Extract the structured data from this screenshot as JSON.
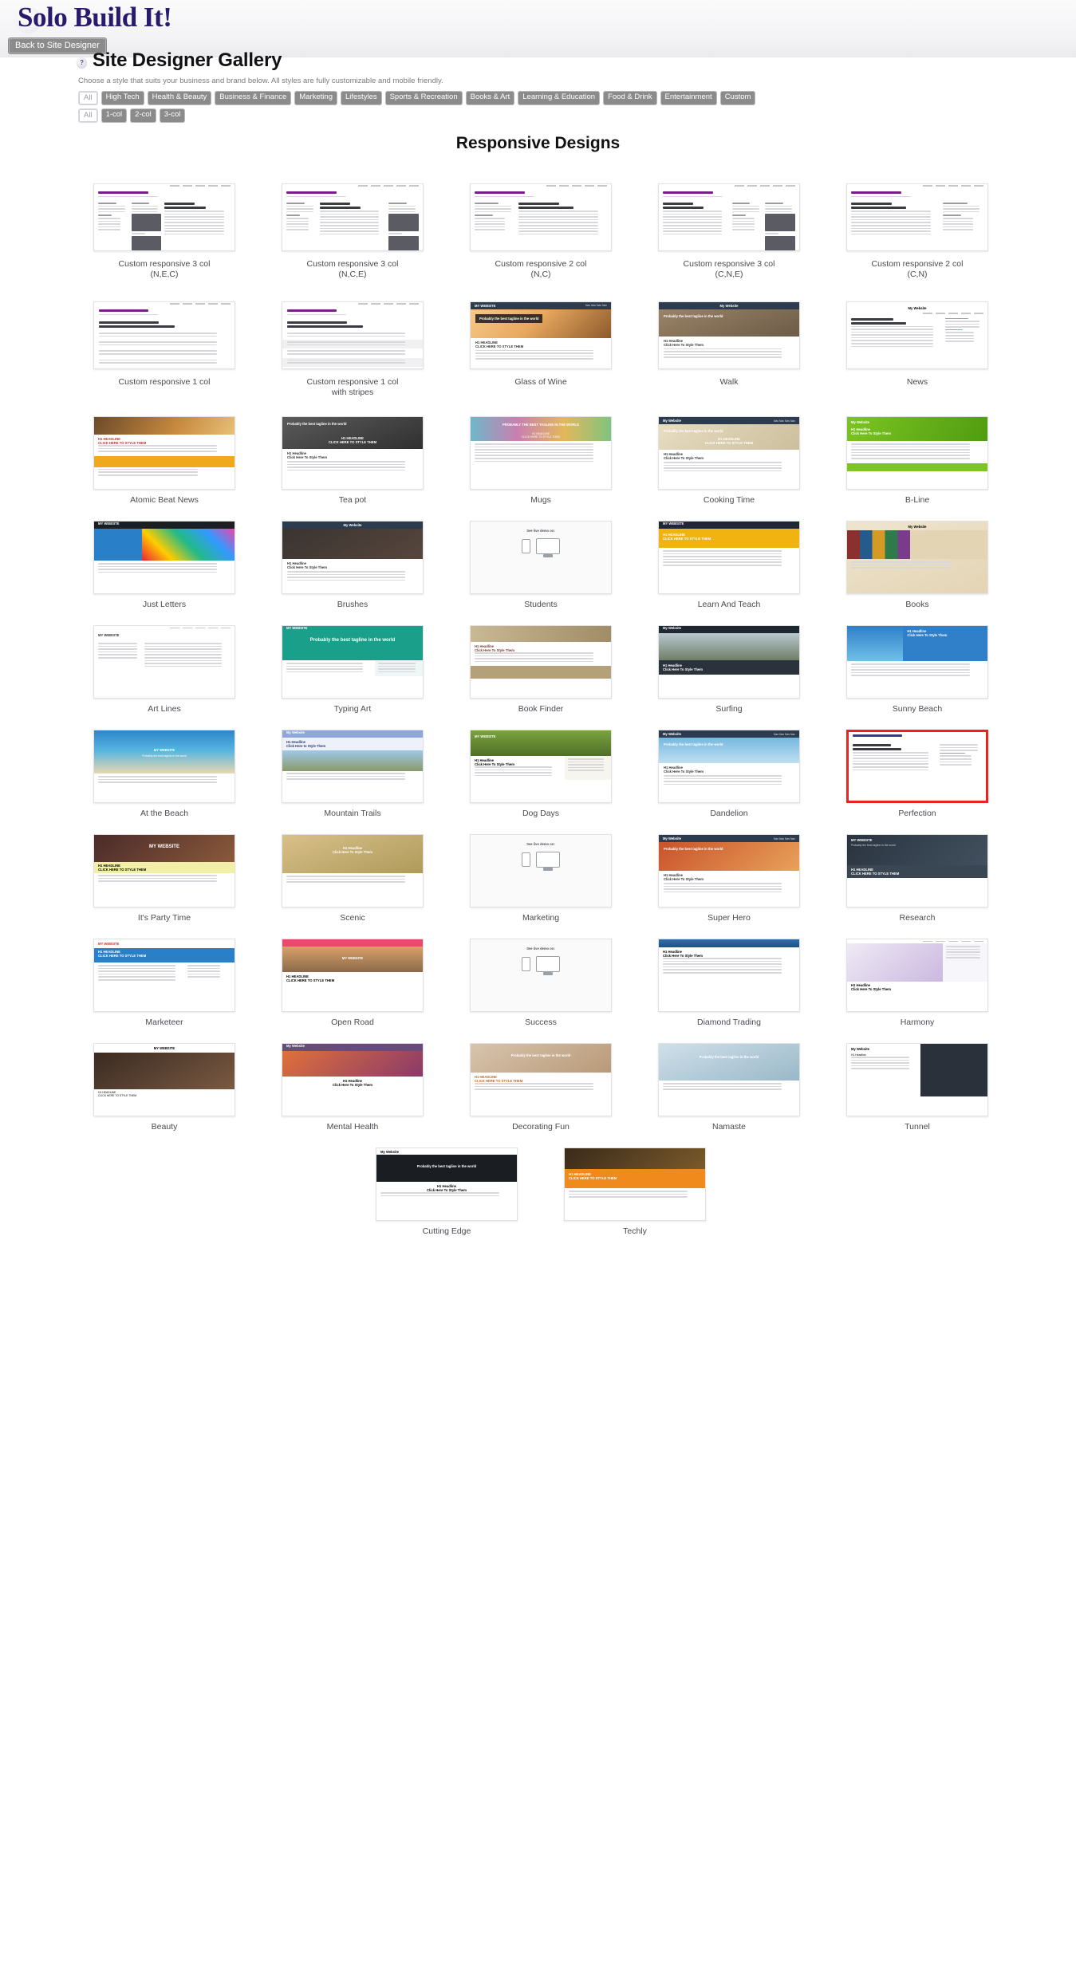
{
  "brand": {
    "name": "Solo Build It!"
  },
  "nav": {
    "back_label": "Back to Site Designer"
  },
  "header": {
    "help_glyph": "?",
    "title": "Site Designer Gallery",
    "subtitle": "Choose a style that suits your business and brand below. All styles are fully customizable and mobile friendly."
  },
  "filters": {
    "category_tags": [
      "All",
      "High Tech",
      "Health & Beauty",
      "Business & Finance",
      "Marketing",
      "Lifestyles",
      "Sports & Recreation",
      "Books & Art",
      "Learning & Education",
      "Food & Drink",
      "Entertainment",
      "Custom"
    ],
    "column_tags": [
      "All",
      "1-col",
      "2-col",
      "3-col"
    ]
  },
  "section": {
    "heading": "Responsive Designs"
  },
  "colors": {
    "brand_purple": "#2a1a6e",
    "tag_grey": "#8b8b8b",
    "selected_red": "#e8241c",
    "caption_grey": "#4a4a52"
  },
  "mini_page_text": {
    "site_name": "My Website",
    "tagline": "Probably the best tagline in the world",
    "h1_line1": "H1 Headline",
    "h1_line2": "Click Here To Style Them",
    "h1_line2_alt": "Click Here to Style Them",
    "h1_caps_line1": "H1 HEADLINE",
    "h1_caps_line2": "CLICK HERE TO STYLE THEM",
    "site_name_caps": "MY WEBSITE",
    "demo_notice": "See live demo on:",
    "nav_column": "Navigation Column",
    "extra_column": "Extra Column"
  },
  "designs": [
    {
      "id": 1,
      "label": "Custom responsive 3 col (N,E,C)",
      "line1": "Custom responsive 3 col",
      "line2": "(N,E,C)",
      "style": "wire3",
      "selected": false
    },
    {
      "id": 2,
      "label": "Custom responsive 3 col (N,C,E)",
      "line1": "Custom responsive 3 col",
      "line2": "(N,C,E)",
      "style": "wire3b",
      "selected": false
    },
    {
      "id": 3,
      "label": "Custom responsive 2 col (N,C)",
      "line1": "Custom responsive 2 col",
      "line2": "(N,C)",
      "style": "wire2",
      "selected": false
    },
    {
      "id": 4,
      "label": "Custom responsive 3 col (C,N,E)",
      "line1": "Custom responsive 3 col",
      "line2": "(C,N,E)",
      "style": "wire3c",
      "selected": false
    },
    {
      "id": 5,
      "label": "Custom responsive 2 col (C,N)",
      "line1": "Custom responsive 2 col",
      "line2": "(C,N)",
      "style": "wire2b",
      "selected": false
    },
    {
      "id": 6,
      "label": "Custom responsive 1 col",
      "line1": "Custom responsive 1 col",
      "line2": "",
      "style": "wire1",
      "selected": false
    },
    {
      "id": 7,
      "label": "Custom responsive 1 col with stripes",
      "line1": "Custom responsive 1 col",
      "line2": "with stripes",
      "style": "wire1s",
      "selected": false
    },
    {
      "id": 8,
      "label": "Glass of Wine",
      "line1": "Glass of Wine",
      "line2": "",
      "style": "wine",
      "selected": false
    },
    {
      "id": 9,
      "label": "Walk",
      "line1": "Walk",
      "line2": "",
      "style": "walk",
      "selected": false
    },
    {
      "id": 10,
      "label": "News",
      "line1": "News",
      "line2": "",
      "style": "news",
      "selected": false
    },
    {
      "id": 11,
      "label": "Atomic Beat News",
      "line1": "Atomic Beat News",
      "line2": "",
      "style": "atomic",
      "selected": false
    },
    {
      "id": 12,
      "label": "Tea pot",
      "line1": "Tea pot",
      "line2": "",
      "style": "teapot",
      "selected": false
    },
    {
      "id": 13,
      "label": "Mugs",
      "line1": "Mugs",
      "line2": "",
      "style": "mugs",
      "selected": false
    },
    {
      "id": 14,
      "label": "Cooking Time",
      "line1": "Cooking Time",
      "line2": "",
      "style": "cooking",
      "selected": false
    },
    {
      "id": 15,
      "label": "B-Line",
      "line1": "B-Line",
      "line2": "",
      "style": "bline",
      "selected": false
    },
    {
      "id": 16,
      "label": "Just Letters",
      "line1": "Just Letters",
      "line2": "",
      "style": "letters",
      "selected": false
    },
    {
      "id": 17,
      "label": "Brushes",
      "line1": "Brushes",
      "line2": "",
      "style": "brushes",
      "selected": false
    },
    {
      "id": 18,
      "label": "Students",
      "line1": "Students",
      "line2": "",
      "style": "demo",
      "selected": false
    },
    {
      "id": 19,
      "label": "Learn And Teach",
      "line1": "Learn And Teach",
      "line2": "",
      "style": "learn",
      "selected": false
    },
    {
      "id": 20,
      "label": "Books",
      "line1": "Books",
      "line2": "",
      "style": "books",
      "selected": false
    },
    {
      "id": 21,
      "label": "Art Lines",
      "line1": "Art Lines",
      "line2": "",
      "style": "artlines",
      "selected": false
    },
    {
      "id": 22,
      "label": "Typing Art",
      "line1": "Typing Art",
      "line2": "",
      "style": "typing",
      "selected": false
    },
    {
      "id": 23,
      "label": "Book Finder",
      "line1": "Book Finder",
      "line2": "",
      "style": "bookfinder",
      "selected": false
    },
    {
      "id": 24,
      "label": "Surfing",
      "line1": "Surfing",
      "line2": "",
      "style": "surfing",
      "selected": false
    },
    {
      "id": 25,
      "label": "Sunny Beach",
      "line1": "Sunny Beach",
      "line2": "",
      "style": "sunny",
      "selected": false
    },
    {
      "id": 26,
      "label": "At the Beach",
      "line1": "At the Beach",
      "line2": "",
      "style": "beach",
      "selected": false
    },
    {
      "id": 27,
      "label": "Mountain Trails",
      "line1": "Mountain Trails",
      "line2": "",
      "style": "mountain",
      "selected": false
    },
    {
      "id": 28,
      "label": "Dog Days",
      "line1": "Dog Days",
      "line2": "",
      "style": "dogs",
      "selected": false
    },
    {
      "id": 29,
      "label": "Dandelion",
      "line1": "Dandelion",
      "line2": "",
      "style": "dandelion",
      "selected": false
    },
    {
      "id": 30,
      "label": "Perfection",
      "line1": "Perfection",
      "line2": "",
      "style": "perfection",
      "selected": true
    },
    {
      "id": 31,
      "label": "It's Party Time",
      "line1": "It's Party Time",
      "line2": "",
      "style": "party",
      "selected": false
    },
    {
      "id": 32,
      "label": "Scenic",
      "line1": "Scenic",
      "line2": "",
      "style": "scenic",
      "selected": false
    },
    {
      "id": 33,
      "label": "Marketing",
      "line1": "Marketing",
      "line2": "",
      "style": "demo",
      "selected": false
    },
    {
      "id": 34,
      "label": "Super Hero",
      "line1": "Super Hero",
      "line2": "",
      "style": "superhero",
      "selected": false
    },
    {
      "id": 35,
      "label": "Research",
      "line1": "Research",
      "line2": "",
      "style": "research",
      "selected": false
    },
    {
      "id": 36,
      "label": "Marketeer",
      "line1": "Marketeer",
      "line2": "",
      "style": "marketeer",
      "selected": false
    },
    {
      "id": 37,
      "label": "Open Road",
      "line1": "Open Road",
      "line2": "",
      "style": "openroad",
      "selected": false
    },
    {
      "id": 38,
      "label": "Success",
      "line1": "Success",
      "line2": "",
      "style": "demo",
      "selected": false
    },
    {
      "id": 39,
      "label": "Diamond Trading",
      "line1": "Diamond Trading",
      "line2": "",
      "style": "diamond",
      "selected": false
    },
    {
      "id": 40,
      "label": "Harmony",
      "line1": "Harmony",
      "line2": "",
      "style": "harmony",
      "selected": false
    },
    {
      "id": 41,
      "label": "Beauty",
      "line1": "Beauty",
      "line2": "",
      "style": "beauty",
      "selected": false
    },
    {
      "id": 42,
      "label": "Mental Health",
      "line1": "Mental Health",
      "line2": "",
      "style": "mental",
      "selected": false
    },
    {
      "id": 43,
      "label": "Decorating Fun",
      "line1": "Decorating Fun",
      "line2": "",
      "style": "decorating",
      "selected": false
    },
    {
      "id": 44,
      "label": "Namaste",
      "line1": "Namaste",
      "line2": "",
      "style": "namaste",
      "selected": false
    },
    {
      "id": 45,
      "label": "Tunnel",
      "line1": "Tunnel",
      "line2": "",
      "style": "tunnel",
      "selected": false
    },
    {
      "id": 46,
      "label": "Cutting Edge",
      "line1": "Cutting Edge",
      "line2": "",
      "style": "cutting",
      "selected": false
    },
    {
      "id": 47,
      "label": "Techly",
      "line1": "Techly",
      "line2": "",
      "style": "techly",
      "selected": false
    }
  ]
}
